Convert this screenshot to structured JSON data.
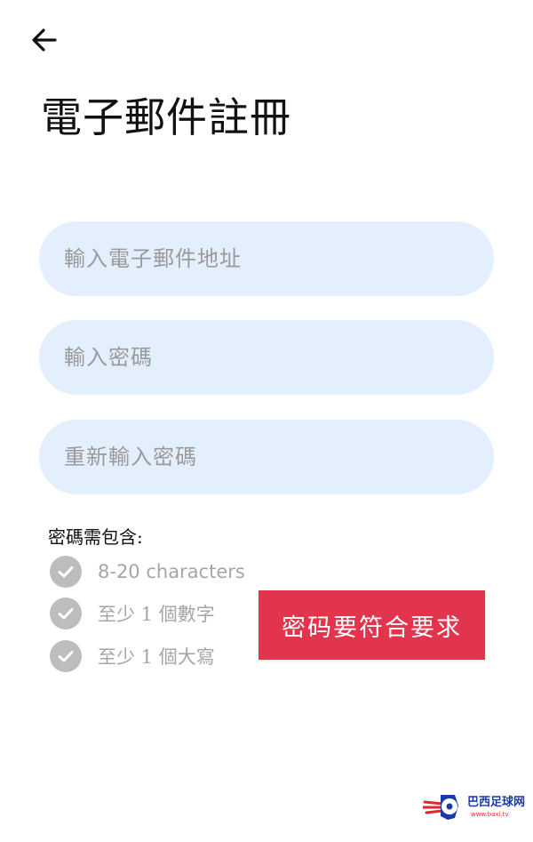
{
  "header": {
    "back_icon": "arrow-left-icon",
    "title": "電子郵件註冊"
  },
  "form": {
    "email": {
      "value": "",
      "placeholder": "輸入電子郵件地址"
    },
    "password": {
      "value": "",
      "placeholder": "輸入密碼"
    },
    "confirm_password": {
      "value": "",
      "placeholder": "重新輸入密碼"
    }
  },
  "requirements": {
    "heading": "密碼需包含:",
    "items": [
      {
        "label": "8-20 characters",
        "icon": "check-circle-icon"
      },
      {
        "label": "至少 1 個數字",
        "icon": "check-circle-icon"
      },
      {
        "label": "至少 1 個大寫",
        "icon": "check-circle-icon"
      }
    ]
  },
  "toast": {
    "message": "密码要符合要求"
  },
  "watermark": {
    "text": "巴西足球网",
    "url": "www.baxi.tv"
  },
  "colors": {
    "field_bg": "#e4effd",
    "placeholder": "#9a9a9a",
    "check_inactive": "#bdbdbd",
    "toast_bg": "#e2344c",
    "title_text": "#111111"
  }
}
